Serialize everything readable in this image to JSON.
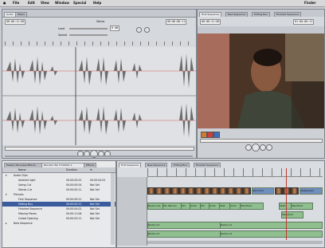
{
  "menubar": {
    "apple": "",
    "items": [
      "File",
      "Edit",
      "View",
      "Window",
      "Special",
      "Help"
    ],
    "right": "Finder"
  },
  "viewer": {
    "tabs": [
      "Audio",
      "Filters"
    ],
    "stereo_label": "Stereo",
    "level_label": "Level",
    "spread_label": "Spread",
    "level_value": "0 dB",
    "timecode_left": "00:00:11:00",
    "timecode_right": "00:00:00:11"
  },
  "canvas": {
    "tabs": [
      "First Sequence",
      "New Sequence",
      "Editing Bus",
      "Finished Sequence"
    ],
    "timecode_left": "00:00:11:00",
    "timecode_right": "01:00:00:11"
  },
  "browser": {
    "tabs": [
      "Eastern Business Effects",
      "Narrator Bin 07/09/01-1",
      "Effects"
    ],
    "columns": [
      "Name",
      "Duration",
      "In"
    ],
    "rows": [
      {
        "name": "Audio Clips",
        "duration": "",
        "in": ""
      },
      {
        "name": "Ambient light",
        "duration": "00:00:05:02",
        "in": "00:00:04:02"
      },
      {
        "name": "Swing Cut",
        "duration": "00:00:00:04",
        "in": "Not Set"
      },
      {
        "name": "Stereo Cut",
        "duration": "00:00:00:11",
        "in": "Not Set"
      },
      {
        "name": "Pictures",
        "duration": "",
        "in": ""
      },
      {
        "name": "First Sequence",
        "duration": "00:00:09:21",
        "in": "Not Set"
      },
      {
        "name": "Editing Bus",
        "duration": "00:00:00:21",
        "in": "Not Set"
      },
      {
        "name": "Finished Sequence",
        "duration": "00:00:04:02",
        "in": "Not Set"
      },
      {
        "name": "Missing Pieces",
        "duration": "00:00:11:06",
        "in": "Not Set"
      },
      {
        "name": "Crowd Opening",
        "duration": "00:00:03:11",
        "in": "Not Set"
      },
      {
        "name": "New Sequence",
        "duration": "",
        "in": ""
      }
    ]
  },
  "timeline": {
    "tabs": [
      "First Sequence",
      "New Sequence",
      "Editing Bus",
      "Finished Sequence"
    ],
    "video_clips": [
      "Swimmer",
      "Skateboard"
    ],
    "audio_row1": [
      "Radio Line",
      "Tax Warren",
      "Skt",
      "Ambi",
      "Skt",
      "Ambi",
      "Skat",
      "Ambi",
      "Wardhum",
      "Skati",
      "Wardhum"
    ],
    "audio_row2_label": "Wardhum",
    "audio_row3": [
      "Radio Lot",
      "Radio Lot"
    ],
    "audio_row4": [
      "Radio Lot",
      "Radio Lot"
    ]
  }
}
